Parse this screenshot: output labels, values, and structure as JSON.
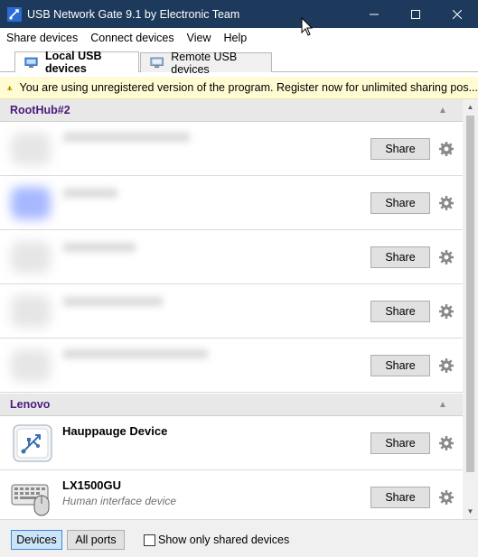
{
  "window": {
    "title": "USB Network Gate 9.1 by Electronic Team"
  },
  "menu": [
    "Share devices",
    "Connect devices",
    "View",
    "Help"
  ],
  "tabs": [
    {
      "label": "Local USB devices",
      "active": true
    },
    {
      "label": "Remote USB devices",
      "active": false
    }
  ],
  "banner": {
    "text": "You are using unregistered version of the program. Register now for unlimited sharing pos..."
  },
  "groups": [
    {
      "name": "RootHub#2",
      "devices": [
        {
          "name": "",
          "desc": "",
          "button": "Share",
          "blurred": true
        },
        {
          "name": "",
          "desc": "",
          "button": "Share",
          "blurred": true
        },
        {
          "name": "",
          "desc": "",
          "button": "Share",
          "blurred": true
        },
        {
          "name": "",
          "desc": "",
          "button": "Share",
          "blurred": true
        },
        {
          "name": "",
          "desc": "",
          "button": "Share",
          "blurred": true
        }
      ]
    },
    {
      "name": "Lenovo",
      "devices": [
        {
          "name": "Hauppauge Device",
          "desc": "",
          "button": "Share",
          "icon": "usb-icon"
        },
        {
          "name": "LX1500GU",
          "desc": "Human interface device",
          "button": "Share",
          "icon": "keyboard-mouse-icon"
        }
      ]
    }
  ],
  "bottom": {
    "devices_btn": "Devices",
    "ports_btn": "All ports",
    "checkbox_label": "Show only shared devices",
    "checkbox_checked": false
  },
  "colors": {
    "titlebar": "#1d3a5c",
    "group_header_text": "#4b1b7c",
    "banner_bg": "#fffcd4"
  }
}
